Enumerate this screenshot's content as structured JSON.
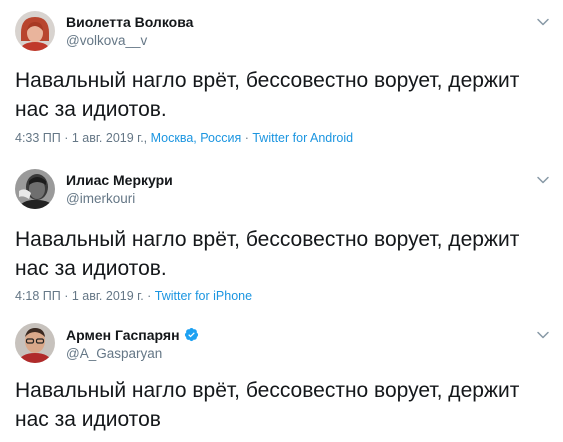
{
  "tweets": [
    {
      "author": "Виолетта Волкова",
      "handle": "@volkova__v",
      "text": "Навальный нагло врёт, бессовестно ворует,  держит нас за идиотов.",
      "time": "4:33 ПП · 1 авг. 2019 г.",
      "separator_1": ", ",
      "location": "Москва, Россия",
      "separator_2": " · ",
      "source": "Twitter for Android",
      "avatar_icon": "user-avatar-woman-red-hair"
    },
    {
      "author": "Илиас Меркури",
      "handle": "@imerkouri",
      "text": "Навальный нагло врёт, бессовестно ворует, держит нас за идиотов.",
      "time": "4:18 ПП · 1 авг. 2019 г.",
      "separator_2": " · ",
      "source": "Twitter for iPhone",
      "avatar_icon": "user-avatar-bw-portrait"
    },
    {
      "author": "Армен Гаспарян",
      "handle": "@A_Gasparyan",
      "text": "Навальный нагло врёт, бессовестно ворует, держит нас за идиотов",
      "verified": true,
      "avatar_icon": "user-avatar-man-glasses"
    }
  ],
  "colors": {
    "text": "#14171a",
    "muted": "#657786",
    "link": "#1b95e0",
    "verified": "#1da1f2"
  }
}
